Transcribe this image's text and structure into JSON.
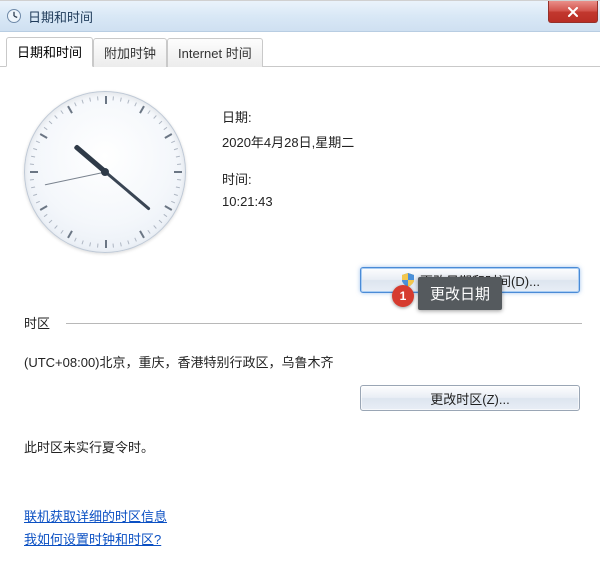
{
  "window": {
    "title": "日期和时间"
  },
  "tabs": [
    {
      "label": "日期和时间",
      "active": true
    },
    {
      "label": "附加时钟",
      "active": false
    },
    {
      "label": "Internet 时间",
      "active": false
    }
  ],
  "datetime": {
    "date_label": "日期:",
    "date_value": "2020年4月28日,星期二",
    "time_label": "时间:",
    "time_value": "10:21:43",
    "clock": {
      "hour": 10,
      "minute": 21,
      "second": 43
    }
  },
  "buttons": {
    "change_datetime": "更改日期和时间(D)...",
    "change_timezone": "更改时区(Z)..."
  },
  "timezone": {
    "section_label": "时区",
    "value": "(UTC+08:00)北京，重庆，香港特别行政区，乌鲁木齐",
    "dst_note": "此时区未实行夏令时。"
  },
  "links": {
    "more_tz_info": "联机获取详细的时区信息",
    "how_to_set": "我如何设置时钟和时区?"
  },
  "annotation": {
    "number": "1",
    "text": "更改日期"
  },
  "icons": {
    "app": "clock-icon",
    "close": "close-icon",
    "shield": "shield-icon"
  }
}
